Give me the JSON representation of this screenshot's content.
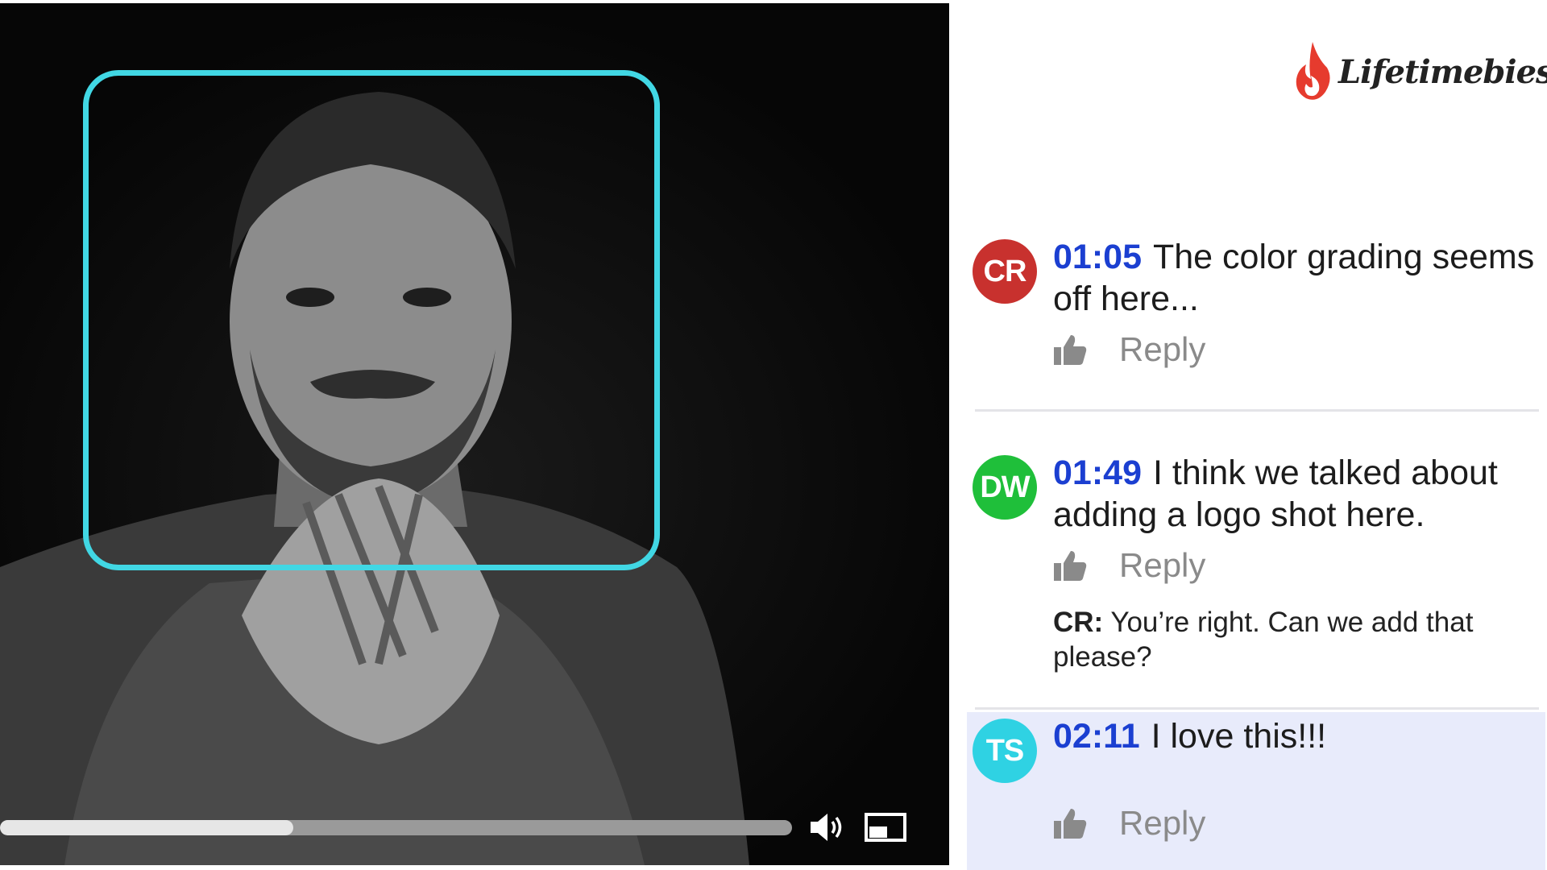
{
  "brand": {
    "name": "Lifetimebies"
  },
  "player": {
    "progress_fraction": 0.37,
    "controls": {
      "volume_icon": "volume-icon",
      "pip_icon": "picture-in-picture-icon"
    }
  },
  "comments": [
    {
      "initials": "CR",
      "avatar_color": "#c8312e",
      "timestamp": "01:05",
      "text": "The color grading seems off here...",
      "reply_label": "Reply"
    },
    {
      "initials": "DW",
      "avatar_color": "#1fbf3a",
      "timestamp": "01:49",
      "text": "I think we talked about adding a logo shot here.",
      "reply_label": "Reply",
      "reply": {
        "author": "CR:",
        "text": "You’re right. Can we add that please?"
      }
    },
    {
      "initials": "TS",
      "avatar_color": "#2fd2e3",
      "timestamp": "02:11",
      "text": "I love this!!!",
      "reply_label": "Reply",
      "highlighted": true
    }
  ],
  "colors": {
    "timestamp": "#1b3fd1",
    "annotation_box": "#41d7e4",
    "highlight": "#e8ebfb"
  }
}
